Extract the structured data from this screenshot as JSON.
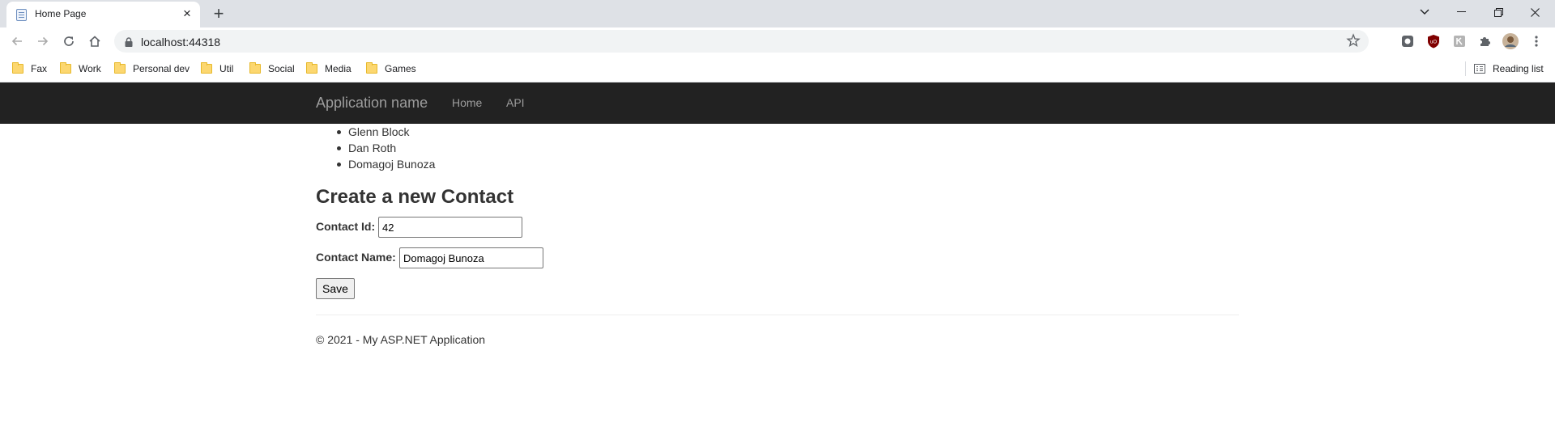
{
  "browser": {
    "tab": {
      "title": "Home Page",
      "favicon": "page-icon",
      "close": "×"
    },
    "new_tab": "+",
    "window_controls": [
      "chevron-down-icon",
      "minimize-icon",
      "restore-icon",
      "close-icon"
    ],
    "url": "localhost:44318",
    "bookmarks": [
      "Fax",
      "Work",
      "Personal dev",
      "Util",
      "Social",
      "Media",
      "Games"
    ],
    "reading_list": "Reading list"
  },
  "navbar": {
    "brand": "Application name",
    "links": [
      "Home",
      "API"
    ]
  },
  "contacts": [
    "Glenn Block",
    "Dan Roth",
    "Domagoj Bunoza"
  ],
  "form": {
    "heading": "Create a new Contact",
    "id_label": "Contact Id:",
    "id_value": "42",
    "name_label": "Contact Name:",
    "name_value": "Domagoj Bunoza",
    "save_label": "Save"
  },
  "footer": "© 2021 - My ASP.NET Application",
  "colors": {
    "navbar": "#222222",
    "nav_text": "#9d9d9d",
    "tabstrip": "#dee1e6"
  }
}
